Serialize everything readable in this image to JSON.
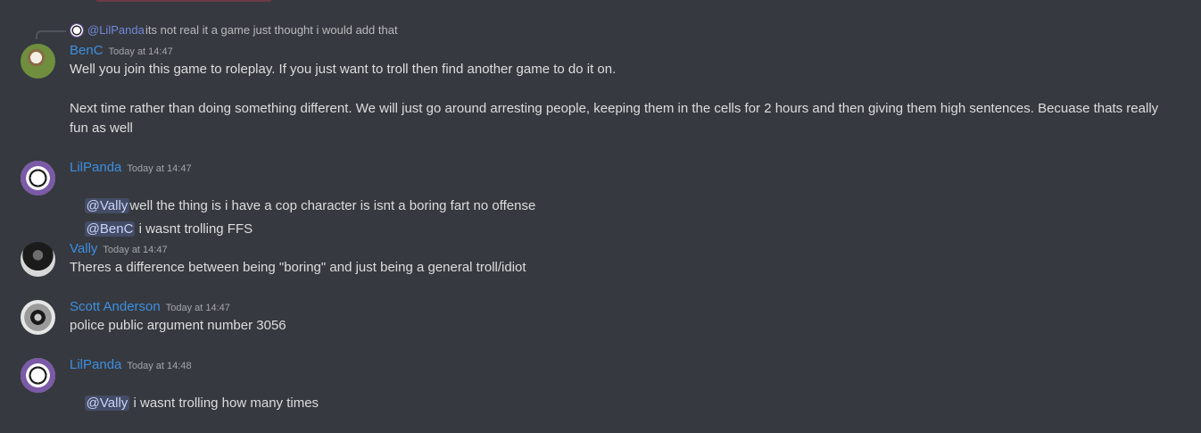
{
  "reply": {
    "mention": "@LilPanda",
    "text": "its not real it a game just thought i would add that"
  },
  "messages": [
    {
      "author": "BenC",
      "timestamp": "Today at 14:47",
      "lines": [
        "Well you join this game to roleplay. If you just want to troll then find another game to do it on.",
        "Next time rather than doing something different. We will just go around arresting people, keeping them in the cells for 2 hours and then giving them high sentences. Becuase thats really",
        "fun as well"
      ]
    },
    {
      "author": "LilPanda",
      "timestamp": "Today at 14:47",
      "lines": [
        {
          "mention": "@Vally",
          "text": "well the thing is i have a cop character is isnt a boring fart no offense"
        },
        {
          "mention": "@BenC",
          "text": " i wasnt trolling FFS"
        }
      ]
    },
    {
      "author": "Vally",
      "timestamp": "Today at 14:47",
      "lines": [
        "Theres a difference between being \"boring\" and just being a general troll/idiot"
      ]
    },
    {
      "author": "Scott Anderson",
      "timestamp": "Today at 14:47",
      "lines": [
        "police public argument number 3056"
      ]
    },
    {
      "author": "LilPanda",
      "timestamp": "Today at 14:48",
      "lines": [
        {
          "mention": "@Vally",
          "text": " i wasnt trolling how many times"
        }
      ]
    }
  ]
}
